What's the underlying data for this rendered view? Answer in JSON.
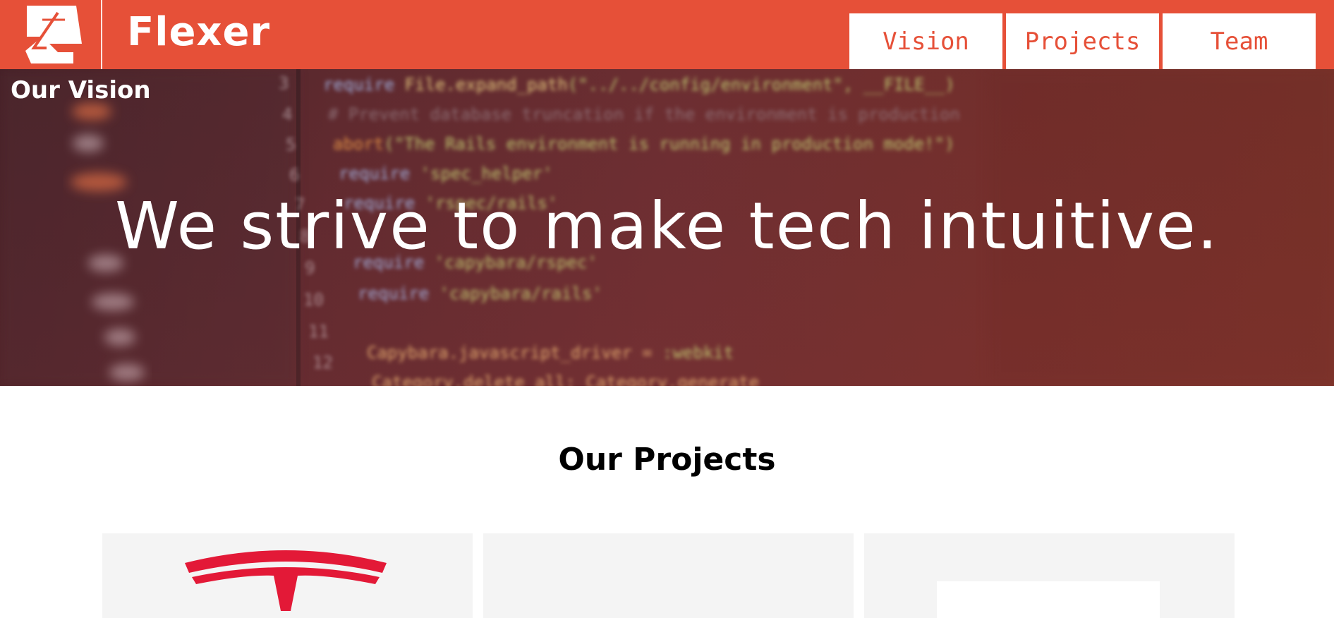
{
  "header": {
    "brand": "Flexer",
    "logo_icon": "flexer-logo-icon",
    "accent_color": "#e65038",
    "nav": [
      {
        "label": "Vision"
      },
      {
        "label": "Projects"
      },
      {
        "label": "Team"
      }
    ]
  },
  "hero": {
    "section_label": "Our Vision",
    "headline": "We strive to make tech intuitive.",
    "background": "blurred code editor"
  },
  "projects": {
    "heading": "Our Projects",
    "cards": [
      {
        "logo_icon": "tesla-logo-icon",
        "logo_color": "#e31937"
      },
      {},
      {
        "thumbnail": "white-placeholder"
      }
    ]
  }
}
